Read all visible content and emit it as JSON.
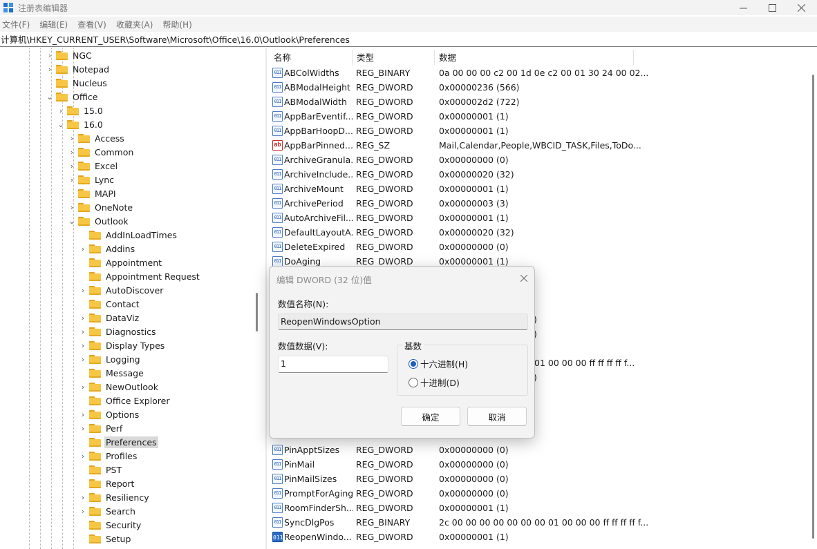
{
  "window": {
    "title": "注册表编辑器"
  },
  "menu": [
    "文件(F)",
    "编辑(E)",
    "查看(V)",
    "收藏夹(A)",
    "帮助(H)"
  ],
  "address": "计算机\\HKEY_CURRENT_USER\\Software\\Microsoft\\Office\\16.0\\Outlook\\Preferences",
  "tree": [
    {
      "label": "NGC",
      "expander": "›"
    },
    {
      "label": "Notepad",
      "expander": "›"
    },
    {
      "label": "Nucleus",
      "expander": ""
    },
    {
      "label": "Office",
      "expander": "⌄"
    },
    {
      "label": "15.0",
      "expander": "›"
    },
    {
      "label": "16.0",
      "expander": "⌄"
    },
    {
      "label": "Access",
      "expander": "›"
    },
    {
      "label": "Common",
      "expander": "›"
    },
    {
      "label": "Excel",
      "expander": "›"
    },
    {
      "label": "Lync",
      "expander": "›"
    },
    {
      "label": "MAPI",
      "expander": ""
    },
    {
      "label": "OneNote",
      "expander": "›"
    },
    {
      "label": "Outlook",
      "expander": "⌄"
    },
    {
      "label": "AddInLoadTimes",
      "expander": ""
    },
    {
      "label": "Addins",
      "expander": "›"
    },
    {
      "label": "Appointment",
      "expander": ""
    },
    {
      "label": "Appointment Request",
      "expander": ""
    },
    {
      "label": "AutoDiscover",
      "expander": "›"
    },
    {
      "label": "Contact",
      "expander": ""
    },
    {
      "label": "DataViz",
      "expander": "›"
    },
    {
      "label": "Diagnostics",
      "expander": "›"
    },
    {
      "label": "Display Types",
      "expander": "›"
    },
    {
      "label": "Logging",
      "expander": "›"
    },
    {
      "label": "Message",
      "expander": ""
    },
    {
      "label": "NewOutlook",
      "expander": "›"
    },
    {
      "label": "Office Explorer",
      "expander": ""
    },
    {
      "label": "Options",
      "expander": "›"
    },
    {
      "label": "Perf",
      "expander": "›"
    },
    {
      "label": "Preferences",
      "expander": "",
      "selected": true
    },
    {
      "label": "Profiles",
      "expander": "›"
    },
    {
      "label": "PST",
      "expander": ""
    },
    {
      "label": "Report",
      "expander": ""
    },
    {
      "label": "Resiliency",
      "expander": "›"
    },
    {
      "label": "Search",
      "expander": "›"
    },
    {
      "label": "Security",
      "expander": ""
    },
    {
      "label": "Setup",
      "expander": ""
    }
  ],
  "list": {
    "headers": [
      "名称",
      "类型",
      "数据"
    ],
    "rows": [
      {
        "name": "ABColWidths",
        "type": "REG_BINARY",
        "data": "0a 00 00 00 c2 00 1d 0e c2 00 01 30 24 00 02...",
        "icon": "bin"
      },
      {
        "name": "ABModalHeight",
        "type": "REG_DWORD",
        "data": "0x00000236 (566)",
        "icon": "bin"
      },
      {
        "name": "ABModalWidth",
        "type": "REG_DWORD",
        "data": "0x000002d2 (722)",
        "icon": "bin"
      },
      {
        "name": "AppBarEventif...",
        "type": "REG_DWORD",
        "data": "0x00000001 (1)",
        "icon": "bin"
      },
      {
        "name": "AppBarHoopD...",
        "type": "REG_DWORD",
        "data": "0x00000001 (1)",
        "icon": "bin"
      },
      {
        "name": "AppBarPinned...",
        "type": "REG_SZ",
        "data": "Mail,Calendar,People,WBCID_TASK,Files,ToDo...",
        "icon": "sz"
      },
      {
        "name": "ArchiveGranula...",
        "type": "REG_DWORD",
        "data": "0x00000000 (0)",
        "icon": "bin"
      },
      {
        "name": "ArchiveInclude...",
        "type": "REG_DWORD",
        "data": "0x00000020 (32)",
        "icon": "bin"
      },
      {
        "name": "ArchiveMount",
        "type": "REG_DWORD",
        "data": "0x00000001 (1)",
        "icon": "bin"
      },
      {
        "name": "ArchivePeriod",
        "type": "REG_DWORD",
        "data": "0x00000003 (3)",
        "icon": "bin"
      },
      {
        "name": "AutoArchiveFil...",
        "type": "REG_DWORD",
        "data": "0x00000001 (1)",
        "icon": "bin"
      },
      {
        "name": "DefaultLayoutA...",
        "type": "REG_DWORD",
        "data": "0x00000020 (32)",
        "icon": "bin"
      },
      {
        "name": "DeleteExpired",
        "type": "REG_DWORD",
        "data": "0x00000000 (0)",
        "icon": "bin"
      },
      {
        "name": "DoAging",
        "type": "REG_DWORD",
        "data": "0x00000001 (1)",
        "icon": "bin"
      }
    ],
    "partial_visible": [
      ")",
      ")",
      "01 00 00 00 ff ff ff ff f...",
      ")"
    ],
    "rows_bottom": [
      {
        "name": "PinApptSizes",
        "type": "REG_DWORD",
        "data": "0x00000000 (0)",
        "icon": "bin"
      },
      {
        "name": "PinMail",
        "type": "REG_DWORD",
        "data": "0x00000000 (0)",
        "icon": "bin"
      },
      {
        "name": "PinMailSizes",
        "type": "REG_DWORD",
        "data": "0x00000000 (0)",
        "icon": "bin"
      },
      {
        "name": "PromptForAging",
        "type": "REG_DWORD",
        "data": "0x00000000 (0)",
        "icon": "bin"
      },
      {
        "name": "RoomFinderSh...",
        "type": "REG_DWORD",
        "data": "0x00000001 (1)",
        "icon": "bin"
      },
      {
        "name": "SyncDlgPos",
        "type": "REG_BINARY",
        "data": "2c 00 00 00 00 00 00 00 01 00 00 00 ff ff ff ff f...",
        "icon": "bin"
      },
      {
        "name": "ReopenWindo...",
        "type": "REG_DWORD",
        "data": "0x00000001 (1)",
        "icon": "sel"
      }
    ]
  },
  "dialog": {
    "title": "编辑 DWORD (32 位)值",
    "name_label": "数值名称(N):",
    "name_value": "ReopenWindowsOption",
    "data_label": "数值数据(V):",
    "data_value": "1",
    "base_label": "基数",
    "hex_label": "十六进制(H)",
    "dec_label": "十进制(D)",
    "base_selected": "hex",
    "ok_label": "确定",
    "cancel_label": "取消"
  }
}
